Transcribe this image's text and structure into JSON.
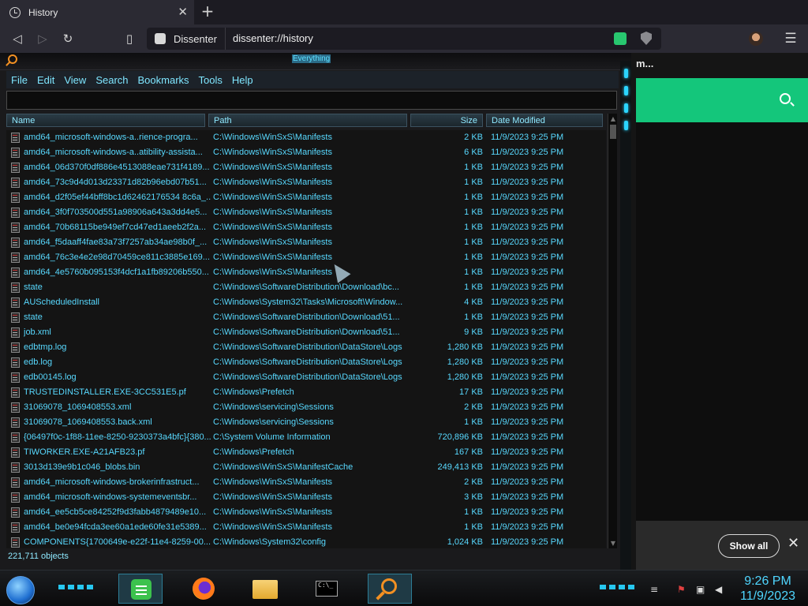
{
  "browser": {
    "tab_title": "History",
    "tab_close": "✕",
    "new_tab": "+",
    "site_name": "Dissenter",
    "url": "dissenter://history"
  },
  "page": {
    "header_fragment": "m...",
    "notification": {
      "show_all": "Show all",
      "close": "✕"
    }
  },
  "everything": {
    "title": "Everything",
    "menu": [
      "File",
      "Edit",
      "View",
      "Search",
      "Bookmarks",
      "Tools",
      "Help"
    ],
    "search_value": "",
    "columns": {
      "name": "Name",
      "path": "Path",
      "size": "Size",
      "date": "Date Modified"
    },
    "rows": [
      [
        "amd64_microsoft-windows-a..rience-progra...",
        "C:\\Windows\\WinSxS\\Manifests",
        "2 KB",
        "11/9/2023 9:25 PM"
      ],
      [
        "amd64_microsoft-windows-a..atibility-assista...",
        "C:\\Windows\\WinSxS\\Manifests",
        "6 KB",
        "11/9/2023 9:25 PM"
      ],
      [
        "amd64_06d370f0df886e4513088eae731f4189...",
        "C:\\Windows\\WinSxS\\Manifests",
        "1 KB",
        "11/9/2023 9:25 PM"
      ],
      [
        "amd64_73c9d4d013d23371d82b96ebd07b51...",
        "C:\\Windows\\WinSxS\\Manifests",
        "1 KB",
        "11/9/2023 9:25 PM"
      ],
      [
        "amd64_d2f05ef44bff8bc1d62462176534 8c6a_...",
        "C:\\Windows\\WinSxS\\Manifests",
        "1 KB",
        "11/9/2023 9:25 PM"
      ],
      [
        "amd64_3f0f703500d551a98906a643a3dd4e5...",
        "C:\\Windows\\WinSxS\\Manifests",
        "1 KB",
        "11/9/2023 9:25 PM"
      ],
      [
        "amd64_70b68115be949ef7cd47ed1aeeb2f2a...",
        "C:\\Windows\\WinSxS\\Manifests",
        "1 KB",
        "11/9/2023 9:25 PM"
      ],
      [
        "amd64_f5daaff4fae83a73f7257ab34ae98b0f_...",
        "C:\\Windows\\WinSxS\\Manifests",
        "1 KB",
        "11/9/2023 9:25 PM"
      ],
      [
        "amd64_76c3e4e2e98d70459ce811c3885e169...",
        "C:\\Windows\\WinSxS\\Manifests",
        "1 KB",
        "11/9/2023 9:25 PM"
      ],
      [
        "amd64_4e5760b095153f4dcf1a1fb89206b550...",
        "C:\\Windows\\WinSxS\\Manifests",
        "1 KB",
        "11/9/2023 9:25 PM"
      ],
      [
        "state",
        "C:\\Windows\\SoftwareDistribution\\Download\\bc...",
        "1 KB",
        "11/9/2023 9:25 PM"
      ],
      [
        "AUScheduledInstall",
        "C:\\Windows\\System32\\Tasks\\Microsoft\\Window...",
        "4 KB",
        "11/9/2023 9:25 PM"
      ],
      [
        "state",
        "C:\\Windows\\SoftwareDistribution\\Download\\51...",
        "1 KB",
        "11/9/2023 9:25 PM"
      ],
      [
        "job.xml",
        "C:\\Windows\\SoftwareDistribution\\Download\\51...",
        "9 KB",
        "11/9/2023 9:25 PM"
      ],
      [
        "edbtmp.log",
        "C:\\Windows\\SoftwareDistribution\\DataStore\\Logs",
        "1,280 KB",
        "11/9/2023 9:25 PM"
      ],
      [
        "edb.log",
        "C:\\Windows\\SoftwareDistribution\\DataStore\\Logs",
        "1,280 KB",
        "11/9/2023 9:25 PM"
      ],
      [
        "edb00145.log",
        "C:\\Windows\\SoftwareDistribution\\DataStore\\Logs",
        "1,280 KB",
        "11/9/2023 9:25 PM"
      ],
      [
        "TRUSTEDINSTALLER.EXE-3CC531E5.pf",
        "C:\\Windows\\Prefetch",
        "17 KB",
        "11/9/2023 9:25 PM"
      ],
      [
        "31069078_1069408553.xml",
        "C:\\Windows\\servicing\\Sessions",
        "2 KB",
        "11/9/2023 9:25 PM"
      ],
      [
        "31069078_1069408553.back.xml",
        "C:\\Windows\\servicing\\Sessions",
        "1 KB",
        "11/9/2023 9:25 PM"
      ],
      [
        "{06497f0c-1f88-11ee-8250-9230373a4bfc}{380...",
        "C:\\System Volume Information",
        "720,896 KB",
        "11/9/2023 9:25 PM"
      ],
      [
        "TIWORKER.EXE-A21AFB23.pf",
        "C:\\Windows\\Prefetch",
        "167 KB",
        "11/9/2023 9:25 PM"
      ],
      [
        "3013d139e9b1c046_blobs.bin",
        "C:\\Windows\\WinSxS\\ManifestCache",
        "249,413 KB",
        "11/9/2023 9:25 PM"
      ],
      [
        "amd64_microsoft-windows-brokerinfrastruct...",
        "C:\\Windows\\WinSxS\\Manifests",
        "2 KB",
        "11/9/2023 9:25 PM"
      ],
      [
        "amd64_microsoft-windows-systemeventsbr...",
        "C:\\Windows\\WinSxS\\Manifests",
        "3 KB",
        "11/9/2023 9:25 PM"
      ],
      [
        "amd64_ee5cb5ce84252f9d3fabb4879489e10...",
        "C:\\Windows\\WinSxS\\Manifests",
        "1 KB",
        "11/9/2023 9:25 PM"
      ],
      [
        "amd64_be0e94fcda3ee60a1ede60fe31e5389...",
        "C:\\Windows\\WinSxS\\Manifests",
        "1 KB",
        "11/9/2023 9:25 PM"
      ],
      [
        "COMPONENTS{1700649e-e22f-11e4-8259-00...",
        "C:\\Windows\\System32\\config",
        "1,024 KB",
        "11/9/2023 9:25 PM"
      ]
    ],
    "status": "221,711 objects"
  },
  "taskbar": {
    "cmd_label": "C:\\_",
    "clock_time": "9:26 PM",
    "clock_date": "11/9/2023"
  },
  "colors": {
    "accent": "#58d9ff",
    "green": "#14c67b",
    "orange": "#f29022"
  }
}
